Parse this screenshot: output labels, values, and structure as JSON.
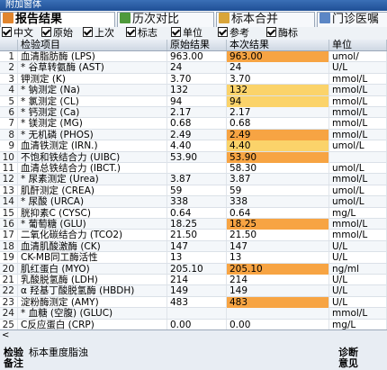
{
  "window": {
    "title": "附加窗体"
  },
  "tabs": [
    {
      "label": "报告结果",
      "active": true,
      "icon": "report-icon"
    },
    {
      "label": "历次对比",
      "active": false,
      "icon": "compare-icon"
    },
    {
      "label": "标本合并",
      "active": false,
      "icon": "merge-icon"
    },
    {
      "label": "门诊医嘱",
      "active": false,
      "icon": "order-icon"
    }
  ],
  "options": [
    {
      "label": "中文",
      "checked": true
    },
    {
      "label": "原始",
      "checked": true
    },
    {
      "label": "上次",
      "checked": true
    },
    {
      "label": "标志",
      "checked": true
    },
    {
      "label": "单位",
      "checked": true
    },
    {
      "label": "参考",
      "checked": true
    },
    {
      "label": "酶标",
      "checked": true
    }
  ],
  "table": {
    "columns": [
      "检验项目",
      "原始结果",
      "本次结果",
      "单位"
    ],
    "rows": [
      {
        "no": "1",
        "name": "血清脂肪酶 (LPS)",
        "orig": "963.00",
        "cur": "963.00",
        "unit": "umol/",
        "hl": "dark"
      },
      {
        "no": "2",
        "name": "* 谷草转氨酶 (AST)",
        "orig": "24",
        "cur": "24",
        "unit": "U/L"
      },
      {
        "no": "3",
        "name": "钾测定 (K)",
        "orig": "3.70",
        "cur": "3.70",
        "unit": "mmol/L"
      },
      {
        "no": "4",
        "name": "* 钠测定 (Na)",
        "orig": "132",
        "cur": "132",
        "unit": "mmol/L",
        "hl": "light"
      },
      {
        "no": "5",
        "name": "* 氯测定 (CL)",
        "orig": "94",
        "cur": "94",
        "unit": "mmol/L",
        "hl": "light"
      },
      {
        "no": "6",
        "name": "* 钙测定 (Ca)",
        "orig": "2.17",
        "cur": "2.17",
        "unit": "mmol/L"
      },
      {
        "no": "7",
        "name": "* 镁测定 (MG)",
        "orig": "0.68",
        "cur": "0.68",
        "unit": "mmol/L"
      },
      {
        "no": "8",
        "name": "* 无机磷 (PHOS)",
        "orig": "2.49",
        "cur": "2.49",
        "unit": "mmol/L",
        "hl": "dark"
      },
      {
        "no": "9",
        "name": "血清铁测定 (IRN.)",
        "orig": "4.40",
        "cur": "4.40",
        "unit": "umol/L",
        "hl": "light"
      },
      {
        "no": "10",
        "name": "不饱和铁结合力 (UIBC)",
        "orig": "53.90",
        "cur": "53.90",
        "unit": "",
        "hl": "dark"
      },
      {
        "no": "11",
        "name": "血清总铁结合力 (IBCT.)",
        "orig": "",
        "cur": "58.30",
        "unit": "umol/L"
      },
      {
        "no": "12",
        "name": "* 尿素测定 (Urea)",
        "orig": "3.87",
        "cur": "3.87",
        "unit": "mmol/L"
      },
      {
        "no": "13",
        "name": "肌酐测定 (CREA)",
        "orig": "59",
        "cur": "59",
        "unit": "umol/L"
      },
      {
        "no": "14",
        "name": "* 尿酸 (URCA)",
        "orig": "338",
        "cur": "338",
        "unit": "umol/L"
      },
      {
        "no": "15",
        "name": "胱抑素C (CYSC)",
        "orig": "0.64",
        "cur": "0.64",
        "unit": "mg/L"
      },
      {
        "no": "16",
        "name": "* 葡萄糖 (GLU)",
        "orig": "18.25",
        "cur": "18.25",
        "unit": "mmol/L",
        "hl": "dark"
      },
      {
        "no": "17",
        "name": "二氧化碳结合力 (TCO2)",
        "orig": "21.50",
        "cur": "21.50",
        "unit": "mmol/L"
      },
      {
        "no": "18",
        "name": "血清肌酸激酶 (CK)",
        "orig": "147",
        "cur": "147",
        "unit": "U/L"
      },
      {
        "no": "19",
        "name": "CK-MB同工酶活性",
        "orig": "13",
        "cur": "13",
        "unit": "U/L"
      },
      {
        "no": "20",
        "name": "肌红蛋白 (MYO)",
        "orig": "205.10",
        "cur": "205.10",
        "unit": "ng/ml",
        "hl": "dark"
      },
      {
        "no": "21",
        "name": "乳酸脱氢酶 (LDH)",
        "orig": "214",
        "cur": "214",
        "unit": "U/L"
      },
      {
        "no": "22",
        "name": "α 羟基丁酸脱氢酶 (HBDH)",
        "orig": "149",
        "cur": "149",
        "unit": "U/L"
      },
      {
        "no": "23",
        "name": "淀粉酶测定 (AMY)",
        "orig": "483",
        "cur": "483",
        "unit": "U/L",
        "hl": "dark"
      },
      {
        "no": "24",
        "name": "* 血糖 (空腹) (GLUC)",
        "orig": "",
        "cur": "",
        "unit": "mmol/L"
      },
      {
        "no": "25",
        "name": "C反应蛋白 (CRP)",
        "orig": "0.00",
        "cur": "0.00",
        "unit": "mg/L"
      }
    ]
  },
  "footer": {
    "scroll_left": "<",
    "remark_label_1": "检验",
    "remark_label_2": "备注",
    "remark_text": "标本重度脂浊",
    "check_label_1": "诊断",
    "check_label_2": "意见"
  },
  "colors": {
    "highlight_dark": "#f7a443",
    "highlight_light": "#fbd36a",
    "titlebar": "#2a5ea8"
  }
}
